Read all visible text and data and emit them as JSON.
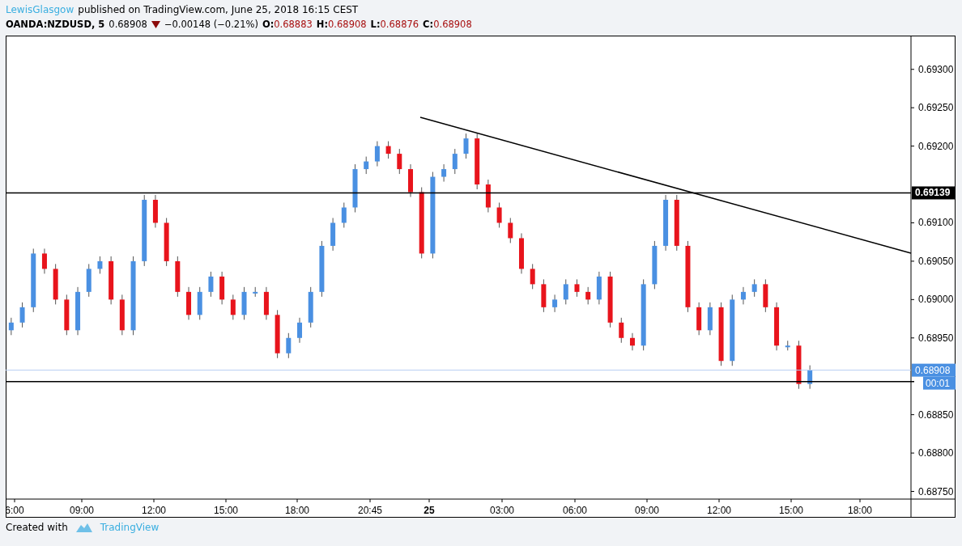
{
  "header": {
    "author": "LewisGlasgow",
    "published": "published on TradingView.com, June 25, 2018 16:15 CEST",
    "symbol": "OANDA:NZDUSD, 5",
    "last": "0.68908",
    "change": "−0.00148 (−0.21%)",
    "ohlc": [
      {
        "label": "O:",
        "value": "0.68883"
      },
      {
        "label": "H:",
        "value": "0.68908"
      },
      {
        "label": "L:",
        "value": "0.68876"
      },
      {
        "label": "C:",
        "value": "0.68908"
      }
    ]
  },
  "chart": {
    "price_axis": [
      "0.69300",
      "0.69250",
      "0.69200",
      "0.69100",
      "0.69050",
      "0.69000",
      "0.68950",
      "0.68850",
      "0.68800",
      "0.68750"
    ],
    "time_axis": [
      {
        "label": "6:00",
        "bold": false
      },
      {
        "label": "09:00",
        "bold": false
      },
      {
        "label": "12:00",
        "bold": false
      },
      {
        "label": "15:00",
        "bold": false
      },
      {
        "label": "18:00",
        "bold": false
      },
      {
        "label": "20:45",
        "bold": false
      },
      {
        "label": "25",
        "bold": true
      },
      {
        "label": "03:00",
        "bold": false
      },
      {
        "label": "06:00",
        "bold": false
      },
      {
        "label": "09:00",
        "bold": false
      },
      {
        "label": "12:00",
        "bold": false
      },
      {
        "label": "15:00",
        "bold": false
      },
      {
        "label": "18:00",
        "bold": false
      }
    ],
    "level_tag": "0.69139",
    "price_tag": "0.68908",
    "countdown": "00:01"
  },
  "footer": {
    "text": "Created with",
    "brand": "TradingView"
  }
}
